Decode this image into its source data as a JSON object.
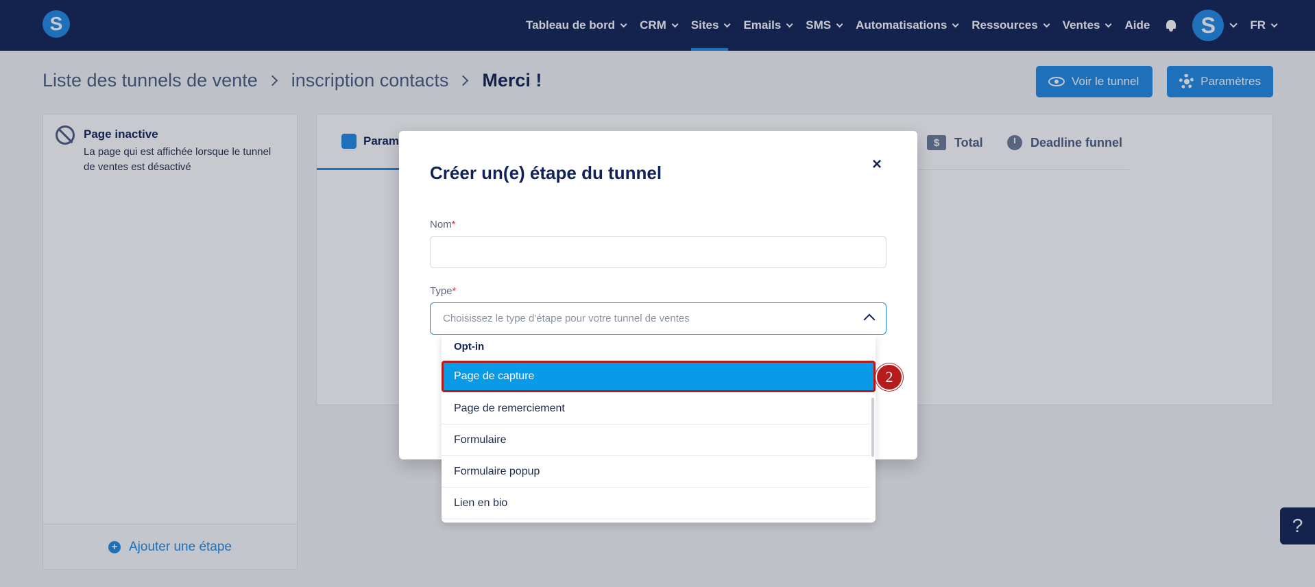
{
  "nav": {
    "logo_letter": "S",
    "items": [
      {
        "label": "Tableau de bord",
        "has_chevron": true,
        "active": false
      },
      {
        "label": "CRM",
        "has_chevron": true,
        "active": false
      },
      {
        "label": "Sites",
        "has_chevron": true,
        "active": true
      },
      {
        "label": "Emails",
        "has_chevron": true,
        "active": false
      },
      {
        "label": "SMS",
        "has_chevron": true,
        "active": false
      },
      {
        "label": "Automatisations",
        "has_chevron": true,
        "active": false
      },
      {
        "label": "Ressources",
        "has_chevron": true,
        "active": false
      },
      {
        "label": "Ventes",
        "has_chevron": true,
        "active": false
      },
      {
        "label": "Aide",
        "has_chevron": false,
        "active": false
      }
    ],
    "avatar_letter": "S",
    "language": "FR",
    "accent_color": "#1e88e5",
    "bg_color": "#112255"
  },
  "breadcrumb": {
    "items": [
      "Liste des tunnels de vente",
      "inscription contacts"
    ],
    "current": "Merci !"
  },
  "actions": {
    "view_label": "Voir le tunnel",
    "params_label": "Paramètres"
  },
  "left_panel": {
    "status_title": "Page inactive",
    "status_desc": "La page qui est affichée lorsque le tunnel de ventes est désactivé",
    "add_step_label": "Ajouter une étape"
  },
  "tabs": {
    "params_label": "Paramètres",
    "total_label": "Total",
    "deadline_label": "Deadline funnel"
  },
  "modal": {
    "title": "Créer un(e) étape du tunnel",
    "close_symbol": "×",
    "name_label": "Nom",
    "name_value": "",
    "type_label": "Type",
    "required_mark": "*",
    "type_placeholder": "Choisissez le type d'étape pour votre tunnel de ventes"
  },
  "dropdown": {
    "group_label": "Opt-in",
    "options": [
      {
        "label": "Page de capture",
        "highlighted": true
      },
      {
        "label": "Page de remerciement",
        "highlighted": false
      },
      {
        "label": "Formulaire",
        "highlighted": false
      },
      {
        "label": "Formulaire popup",
        "highlighted": false
      },
      {
        "label": "Lien en bio",
        "highlighted": false
      }
    ]
  },
  "annotation": {
    "step_number": "2",
    "color": "#b71c1c"
  },
  "help": {
    "symbol": "?"
  }
}
